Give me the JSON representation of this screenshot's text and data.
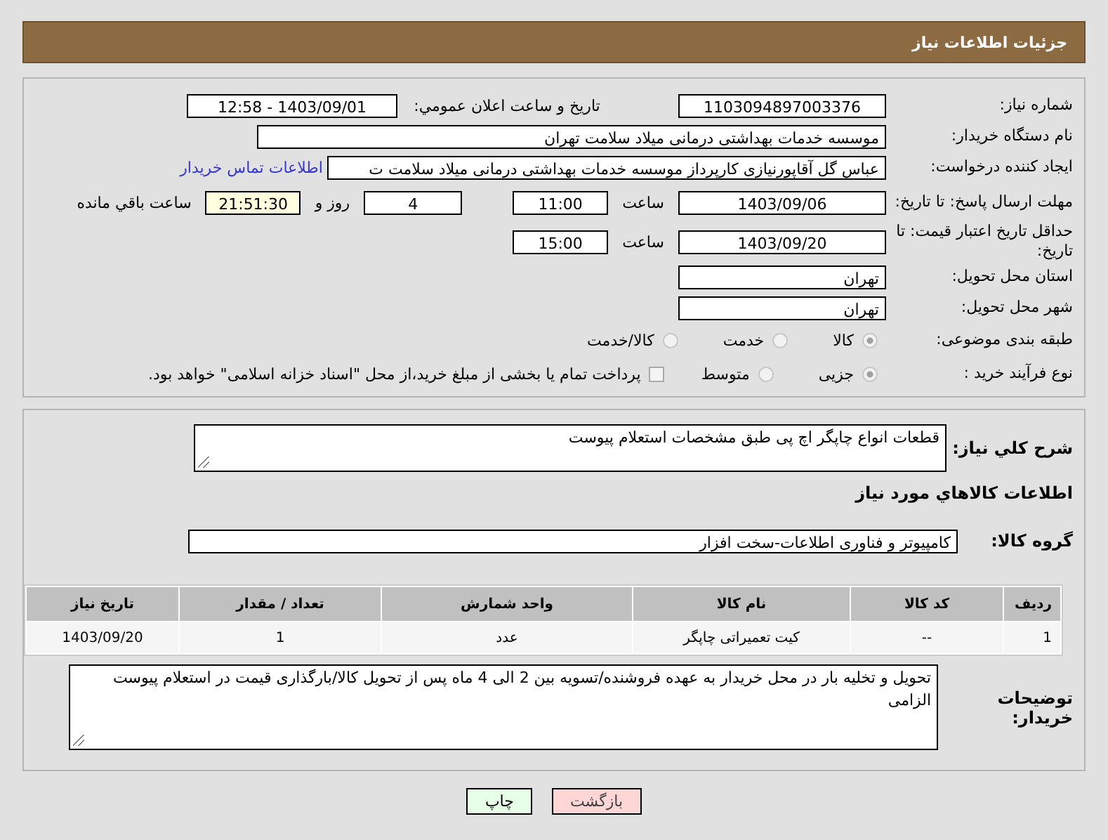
{
  "header": {
    "title": "جزئیات اطلاعات نیاز"
  },
  "details": {
    "need_number": {
      "label": "شماره نیاز:",
      "value": "1103094897003376"
    },
    "announce": {
      "label": "تاریخ و ساعت اعلان عمومي:",
      "value": "1403/09/01 - 12:58"
    },
    "buyer": {
      "label": "نام دستگاه خریدار:",
      "value": "موسسه خدمات بهداشتی درمانی میلاد سلامت تهران"
    },
    "creator": {
      "label": "ایجاد کننده درخواست:",
      "value": "عباس گل آقاپورنیازی کارپرداز موسسه خدمات بهداشتی درمانی میلاد سلامت ت",
      "link": "اطلاعات تماس خریدار"
    },
    "deadline": {
      "label": "مهلت ارسال پاسخ: تا تاریخ:",
      "date": "1403/09/06",
      "time_label": "ساعت",
      "time": "11:00",
      "days": "4",
      "days_label": "روز و",
      "remaining": "21:51:30",
      "remaining_label": "ساعت باقي مانده"
    },
    "validity": {
      "label": "حداقل تاریخ اعتبار قیمت: تا تاریخ:",
      "date": "1403/09/20",
      "time_label": "ساعت",
      "time": "15:00"
    },
    "province": {
      "label": "استان محل تحویل:",
      "value": "تهران"
    },
    "city": {
      "label": "شهر محل تحویل:",
      "value": "تهران"
    },
    "category": {
      "label": "طبقه بندی موضوعی:",
      "options": [
        {
          "label": "کالا",
          "selected": true
        },
        {
          "label": "خدمت",
          "selected": false
        },
        {
          "label": "کالا/خدمت",
          "selected": false
        }
      ]
    },
    "process": {
      "label": "نوع فرآیند خرید :",
      "options": [
        {
          "label": "جزیی",
          "selected": true
        },
        {
          "label": "متوسط",
          "selected": false
        }
      ],
      "treasury": {
        "label": "پرداخت تمام یا بخشی از مبلغ خرید،از محل \"اسناد خزانه اسلامی\" خواهد بود.",
        "checked": false
      }
    }
  },
  "needs": {
    "description": {
      "label": "شرح كلي نياز:",
      "value": "قطعات انواع چاپگر اچ پی طبق مشخصات استعلام پیوست"
    },
    "heading": "اطلاعات كالاهاي مورد نياز",
    "group": {
      "label": "گروه کالا:",
      "value": "کامپیوتر و فناوری اطلاعات-سخت افزار"
    },
    "table": {
      "columns": [
        "رديف",
        "کد کالا",
        "نام کالا",
        "واحد شمارش",
        "تعداد / مقدار",
        "تاریخ نیاز"
      ],
      "rows": [
        [
          "1",
          "--",
          "کیت تعمیراتی چاپگر",
          "عدد",
          "1",
          "1403/09/20"
        ]
      ]
    },
    "notes": {
      "label": "توضیحات خریدار:",
      "value": "تحویل و تخلیه بار در محل خریدار به عهده فروشنده/تسویه بین 2 الی 4 ماه پس از تحویل کالا/بارگذاری قیمت در استعلام پیوست الزامی"
    }
  },
  "buttons": [
    {
      "label": "بازگشت",
      "kind": "back"
    },
    {
      "label": "چاپ",
      "kind": "print"
    }
  ]
}
